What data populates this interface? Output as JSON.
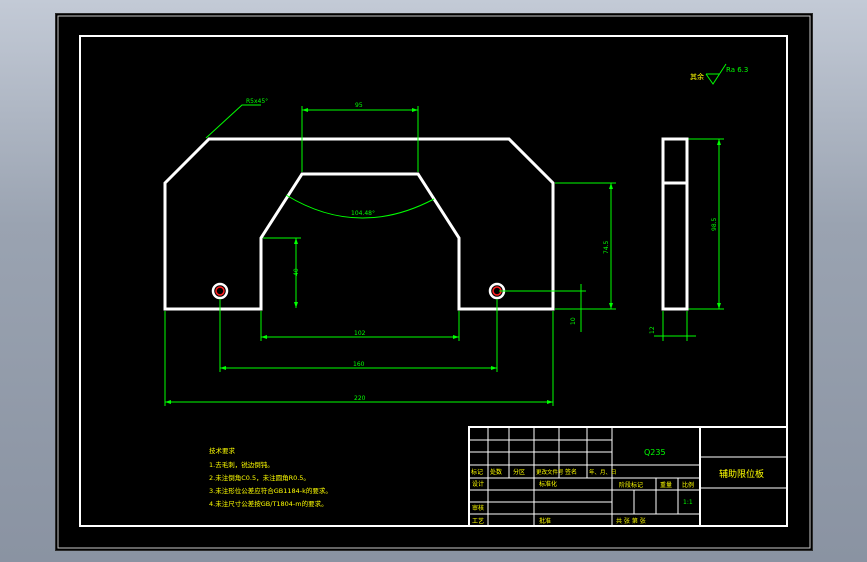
{
  "colors": {
    "background": "#000000",
    "frame": "#ffffff",
    "part_outline": "#ffffff",
    "dimension": "#00ff00",
    "notes": "#ffff00",
    "hole_mark": "#ff2020"
  },
  "roughness": {
    "prefix": "其余",
    "value": "Ra 6.3"
  },
  "chamfer_label": "R5x45°",
  "dimensions": {
    "top_opening": "95",
    "angle": "104.48°",
    "left_inner_height": "40",
    "right_height": "74.5",
    "bottom_inner": "102",
    "hole_spacing": "160",
    "overall_width": "220",
    "hole_offset": "10",
    "side_height": "98.5",
    "side_thickness": "12"
  },
  "technical_notes": {
    "title": "技术要求",
    "items": [
      "1.去毛刺，锐边倒钝。",
      "2.未注倒角C0.5，未注圆角R0.5。",
      "3.未注形位公差应符合GB1184-k的要求。",
      "4.未注尺寸公差按GB/T1804-m的要求。"
    ]
  },
  "title_block": {
    "material": "Q235",
    "part_name": "辅助限位板",
    "header_labels": [
      "标记",
      "处数",
      "分区",
      "更改文件号",
      "签名",
      "年、月、日"
    ],
    "design_label": "设计",
    "standardize_label": "标准化",
    "review_label": "审核",
    "process_label": "工艺",
    "approve_label": "批准",
    "stage_label": "阶段标记",
    "weight_label": "重量",
    "scale_label": "比例",
    "scale_value": "1:1",
    "sheets_label": "共  张  第  张"
  }
}
